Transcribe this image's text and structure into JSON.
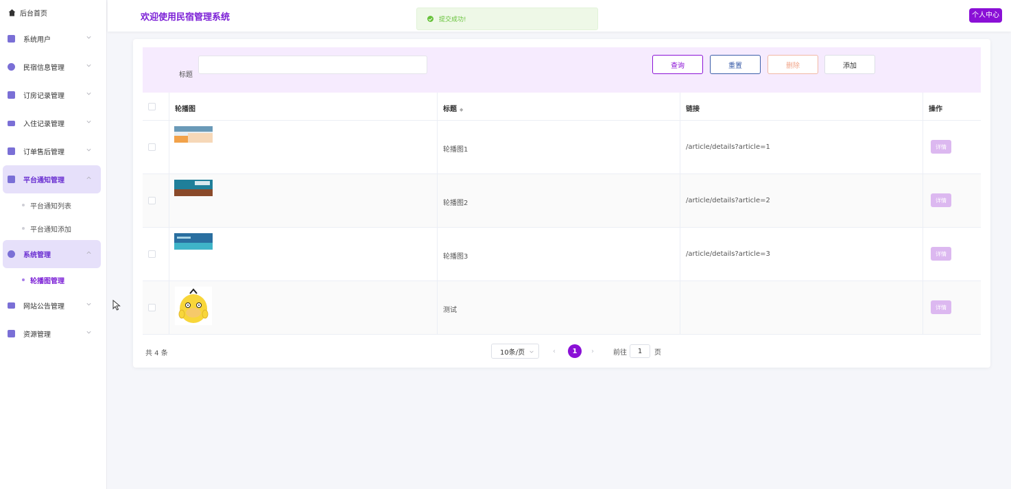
{
  "sidebar": {
    "home": "后台首页",
    "menus": [
      {
        "label": "系统用户"
      },
      {
        "label": "民宿信息管理"
      },
      {
        "label": "订房记录管理"
      },
      {
        "label": "入住记录管理"
      },
      {
        "label": "订单售后管理"
      },
      {
        "label": "平台通知管理"
      },
      {
        "label": "系统管理"
      },
      {
        "label": "网站公告管理"
      },
      {
        "label": "资源管理"
      }
    ],
    "sub_notice": [
      "平台通知列表",
      "平台通知添加"
    ],
    "sub_system": [
      "轮播图管理"
    ]
  },
  "header": {
    "title": "欢迎使用民宿管理系统",
    "user_center": "个人中心"
  },
  "toast": {
    "message": "提交成功!"
  },
  "search": {
    "label": "标题",
    "value": "",
    "buttons": {
      "query": "查询",
      "reset": "重置",
      "delete": "删除",
      "add": "添加"
    }
  },
  "table": {
    "columns": [
      "轮播图",
      "标题",
      "链接",
      "操作"
    ],
    "sort_icon": "sort-icon",
    "rows": [
      {
        "title": "轮播图1",
        "link": "/article/details?article=1",
        "action": "详情"
      },
      {
        "title": "轮播图2",
        "link": "/article/details?article=2",
        "action": "详情"
      },
      {
        "title": "轮播图3",
        "link": "/article/details?article=3",
        "action": "详情"
      },
      {
        "title": "测试",
        "link": "",
        "action": "详情"
      }
    ]
  },
  "pagination": {
    "total": "共 4 条",
    "page_size": "10条/页",
    "current": "1",
    "goto_prefix": "前往",
    "goto_value": "1",
    "goto_suffix": "页"
  },
  "colors": {
    "accent": "#8a10d6",
    "search_bg": "#f6ebfe",
    "detail_button": "#dcb8f0",
    "success": "#67c23a"
  }
}
